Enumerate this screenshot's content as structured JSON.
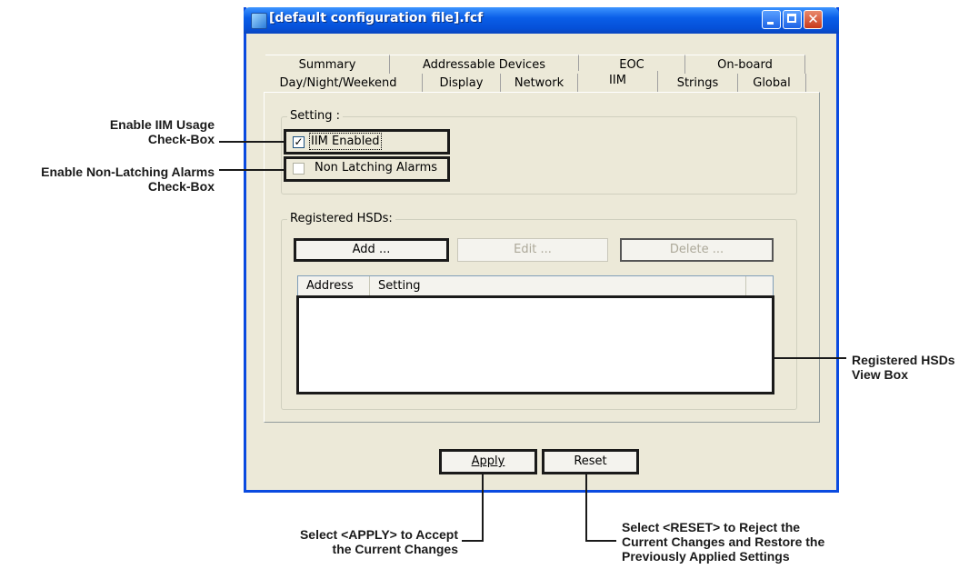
{
  "window": {
    "title": "[default configuration file].fcf",
    "minimize_label": "_",
    "maximize_label": "□",
    "close_label": "✕"
  },
  "tabs": {
    "back_row": [
      "Summary",
      "Addressable Devices",
      "EOC",
      "On-board"
    ],
    "front_row": [
      "Day/Night/Weekend",
      "Display",
      "Network",
      "IIM",
      "Strings",
      "Global"
    ],
    "active": "IIM"
  },
  "setting_group": {
    "legend": "Setting :",
    "iim_enabled": {
      "label": "IIM Enabled",
      "checked": true
    },
    "non_latching": {
      "label": "Non Latching Alarms",
      "checked": false
    }
  },
  "hsd_group": {
    "legend": "Registered HSDs:",
    "add_label": "Add ...",
    "edit_label": "Edit ...",
    "delete_label": "Delete ...",
    "columns": [
      "Address",
      "Setting"
    ]
  },
  "footer": {
    "apply_label": "Apply",
    "reset_label": "Reset"
  },
  "annotations": {
    "iim_usage_1": "Enable IIM Usage",
    "iim_usage_2": "Check-Box",
    "non_latching_1": "Enable Non-Latching Alarms",
    "non_latching_2": "Check-Box",
    "hsd_view_1": "Registered HSDs",
    "hsd_view_2": "View Box",
    "apply_1": "Select <APPLY> to Accept",
    "apply_2": "the Current Changes",
    "reset_1": "Select <RESET> to Reject the",
    "reset_2": "Current Changes and Restore the",
    "reset_3": "Previously Applied Settings"
  },
  "colors": {
    "titlebar": "#0a5ee8",
    "window_face": "#ece9d8",
    "annotation": "#1a1a1a"
  }
}
